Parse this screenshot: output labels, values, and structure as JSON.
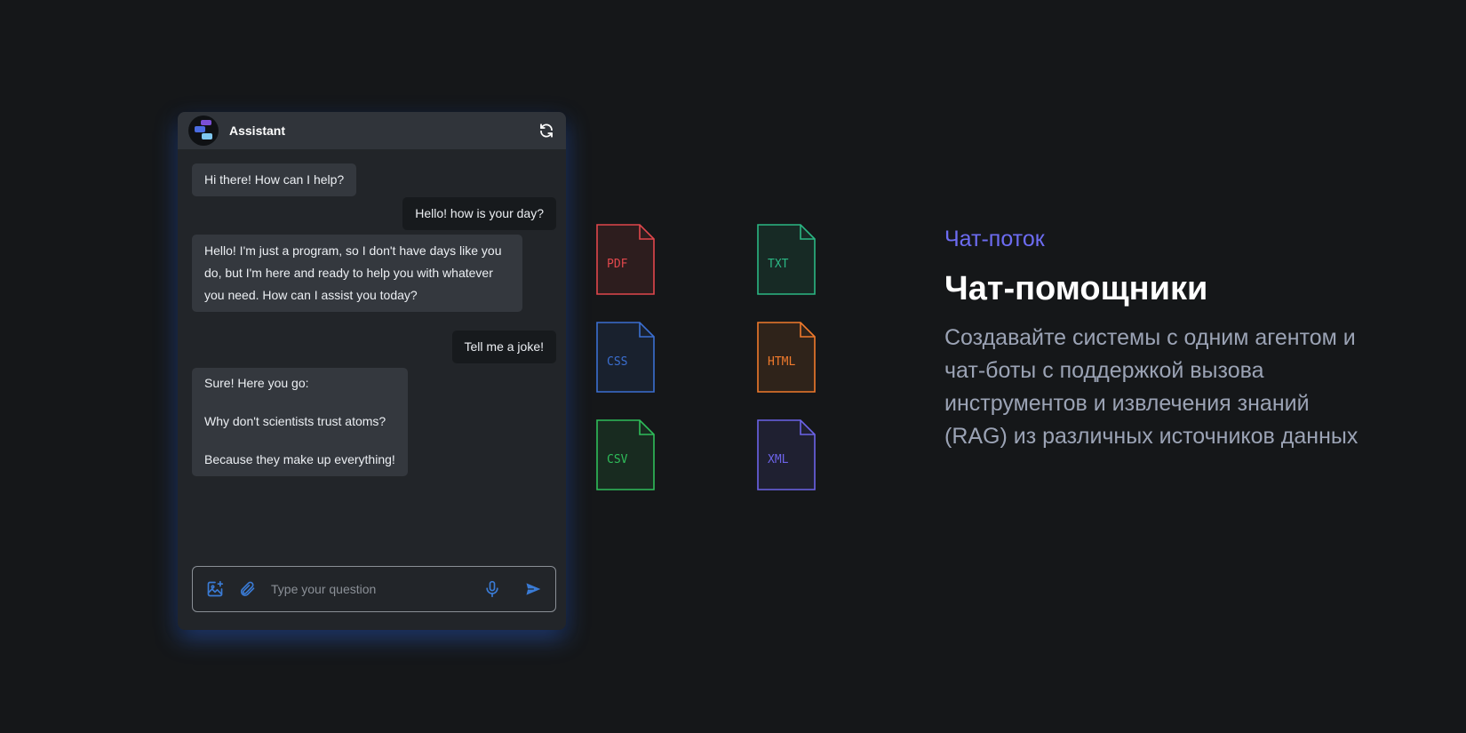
{
  "chat": {
    "title": "Assistant",
    "header_icon": "refresh-icon",
    "messages": [
      {
        "role": "bot",
        "text": "Hi there! How can I help?"
      },
      {
        "role": "user",
        "text": "Hello! how is your day?"
      },
      {
        "role": "bot",
        "text": "Hello! I'm just a program, so I don't have days like you do, but I'm here and ready to help you with whatever you need. How can I assist you today?"
      },
      {
        "role": "user",
        "text": "Tell me a joke!"
      },
      {
        "role": "bot",
        "text": "Sure! Here you go:\n\nWhy don't scientists trust atoms?\n\nBecause they make up everything!"
      }
    ],
    "composer": {
      "placeholder": "Type your question",
      "icons": [
        "image-upload-icon",
        "paperclip-icon",
        "microphone-icon",
        "send-icon"
      ]
    },
    "accent_color": "#3a7bd5"
  },
  "files": [
    {
      "label": "PDF",
      "color": "#e0474c"
    },
    {
      "label": "TXT",
      "color": "#2bb784"
    },
    {
      "label": "CSS",
      "color": "#3b6fd1"
    },
    {
      "label": "HTML",
      "color": "#f07a2c"
    },
    {
      "label": "CSV",
      "color": "#2fbd5a"
    },
    {
      "label": "XML",
      "color": "#6c63e8"
    }
  ],
  "info": {
    "eyebrow": "Чат-поток",
    "headline": "Чат-помощники",
    "description": "Создавайте системы с одним агентом и чат-боты с поддержкой вызова инструментов и извлечения знаний (RAG) из различных источников данных",
    "eyebrow_color": "#6d6cf2"
  }
}
